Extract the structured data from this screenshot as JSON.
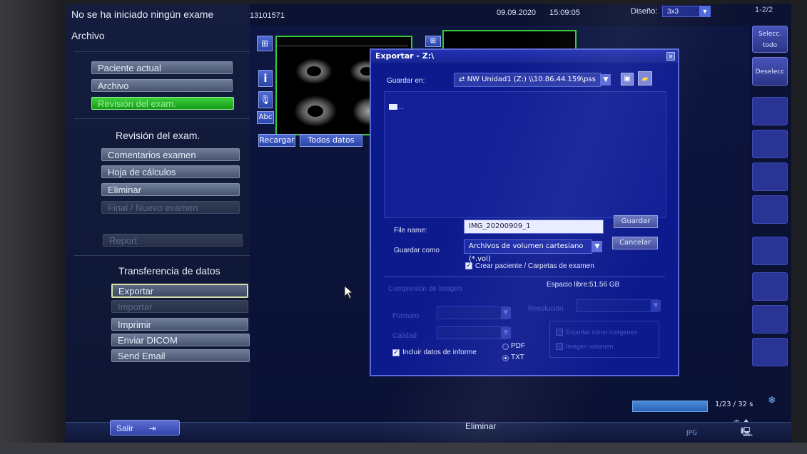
{
  "left_panel": {
    "status_line": "No se ha iniciado ningún exame",
    "section_archive": "Archivo",
    "nav": {
      "current_patient": "Paciente actual",
      "archive": "Archivo",
      "exam_review": "Revisión del exam."
    },
    "review_section": {
      "heading": "Revisión del exam.",
      "comments": "Comentarios examen",
      "worksheet": "Hoja de cálculos",
      "delete": "Eliminar",
      "end_new_exam": "Final / Nuevo examen",
      "report": "Report"
    },
    "transfer_section": {
      "heading": "Transferencia de datos",
      "export": "Exportar",
      "import": "Importar",
      "print": "Imprimir",
      "send_dicom": "Enviar DICOM",
      "send_email": "Send Email"
    },
    "exit_label": "Salir"
  },
  "top_bar": {
    "patient_id": "13101571",
    "date": "09.09.2020",
    "time": "15:09:05",
    "layout_label": "Diseño:",
    "layout_value": "3x3",
    "page": "1-2/2"
  },
  "right_column": {
    "select_all": "Selecc. todo",
    "deselect": "Deselecc"
  },
  "image_toolbar": {
    "info_icon_label": "i",
    "abc_label": "Abc",
    "reload": "Recargar",
    "all_data": "Todos datos"
  },
  "dialog": {
    "title": "Exportar - Z:\\",
    "save_in_label": "Guardar en:",
    "save_in_value": "NW Unidad1 (Z:) \\\\10.86.44.159\\pss",
    "folder_up_item": "..",
    "file_name_label": "File name:",
    "file_name_value": "IMG_20200909_1",
    "save_button": "Guardar",
    "save_as_label": "Guardar como",
    "save_as_value": "Archivos de volumen cartesiano (*.vol)",
    "cancel_button": "Cancelar",
    "create_patient_label": "Crear paciente / Carpetas de examen",
    "free_space_label": "Espacio libre:",
    "free_space_value": "51.56 GB",
    "image_compression_label": "Compresión de imagen",
    "format_label": "Formato",
    "quality_label": "Calidad",
    "resolution_label": "Resolución",
    "include_report_label": "Incluir datos de informe",
    "pdf_label": "PDF",
    "txt_label": "TXT",
    "option_1_label": "Exportar como imágenes",
    "option_2_label": "Imagen volumen"
  },
  "bottom_bar": {
    "delete_label": "Eliminar",
    "counter": "1/23 / 32 s",
    "format_badge": "JPG"
  }
}
